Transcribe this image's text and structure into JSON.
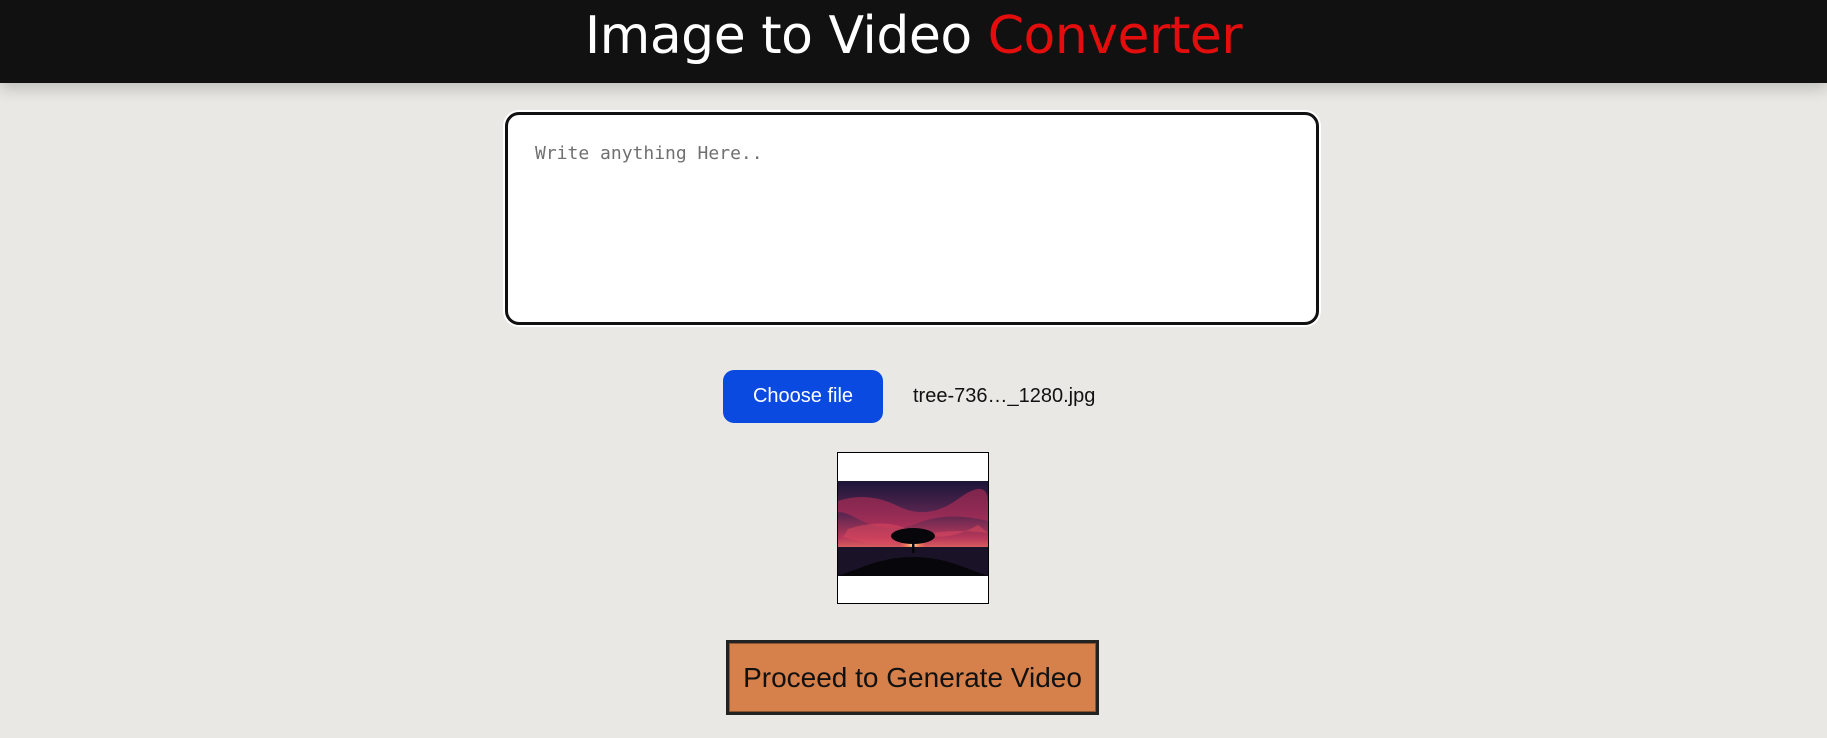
{
  "header": {
    "title_main": "Image to Video ",
    "title_accent": "Converter",
    "accent_color": "#e30d0d"
  },
  "text_input": {
    "placeholder": "Write anything Here..",
    "value": ""
  },
  "file_picker": {
    "button_label": "Choose file",
    "file_name": "tree-736…_1280.jpg",
    "button_color": "#0a4ae0"
  },
  "preview": {
    "icon": "image-preview"
  },
  "action": {
    "proceed_label": "Proceed to Generate Video",
    "button_color": "#d6804b"
  }
}
